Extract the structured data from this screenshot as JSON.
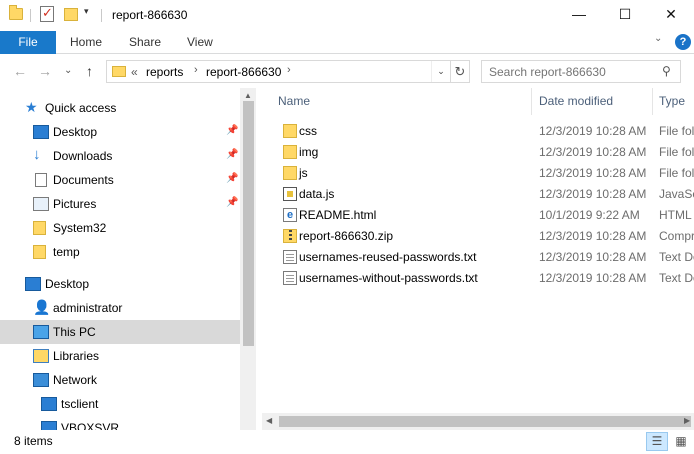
{
  "window": {
    "title": "report-866630",
    "minimize": "—",
    "maximize": "☐",
    "close": "✕"
  },
  "quick_toolbar": {
    "dropdown": "▾",
    "separator": "|"
  },
  "ribbon": {
    "tabs": [
      "File",
      "Home",
      "Share",
      "View"
    ],
    "expand": "⌄",
    "help": "?"
  },
  "navigation": {
    "back": "←",
    "forward": "→",
    "recent": "⌄",
    "up": "↑",
    "address": {
      "overflow": "«",
      "crumbs": [
        "reports",
        "report-866630"
      ],
      "chevron": "›",
      "dropdown": "⌄",
      "refresh": "↻"
    },
    "search": {
      "placeholder": "Search report-866630",
      "icon": "⚲"
    }
  },
  "sidebar": {
    "items": [
      {
        "label": "Quick access",
        "icon": "star-icon"
      },
      {
        "label": "Desktop",
        "icon": "desktop-icon",
        "pinned": true
      },
      {
        "label": "Downloads",
        "icon": "downloads-icon",
        "pinned": true
      },
      {
        "label": "Documents",
        "icon": "documents-icon",
        "pinned": true
      },
      {
        "label": "Pictures",
        "icon": "pictures-icon",
        "pinned": true
      },
      {
        "label": "System32",
        "icon": "folder-icon"
      },
      {
        "label": "temp",
        "icon": "folder-icon"
      },
      {
        "label": "Desktop",
        "icon": "desktop-icon"
      },
      {
        "label": "administrator",
        "icon": "user-icon"
      },
      {
        "label": "This PC",
        "icon": "computer-icon",
        "selected": true
      },
      {
        "label": "Libraries",
        "icon": "libraries-icon"
      },
      {
        "label": "Network",
        "icon": "network-icon"
      },
      {
        "label": "tsclient",
        "icon": "computer-icon"
      },
      {
        "label": "VBOXSVR",
        "icon": "computer-icon"
      }
    ],
    "pin_glyph": "📌"
  },
  "file_list": {
    "columns": {
      "name": "Name",
      "date": "Date modified",
      "type": "Type"
    },
    "sort_arrow": "^",
    "rows": [
      {
        "name": "css",
        "date": "12/3/2019 10:28 AM",
        "type": "File fol",
        "icon": "folder-icon"
      },
      {
        "name": "img",
        "date": "12/3/2019 10:28 AM",
        "type": "File fol",
        "icon": "folder-icon"
      },
      {
        "name": "js",
        "date": "12/3/2019 10:28 AM",
        "type": "File fol",
        "icon": "folder-icon"
      },
      {
        "name": "data.js",
        "date": "12/3/2019 10:28 AM",
        "type": "JavaSc",
        "icon": "js-file-icon"
      },
      {
        "name": "README.html",
        "date": "10/1/2019 9:22 AM",
        "type": "HTML",
        "icon": "html-file-icon"
      },
      {
        "name": "report-866630.zip",
        "date": "12/3/2019 10:28 AM",
        "type": "Compr",
        "icon": "zip-file-icon"
      },
      {
        "name": "usernames-reused-passwords.txt",
        "date": "12/3/2019 10:28 AM",
        "type": "Text Do",
        "icon": "text-file-icon"
      },
      {
        "name": "usernames-without-passwords.txt",
        "date": "12/3/2019 10:28 AM",
        "type": "Text Do",
        "icon": "text-file-icon"
      }
    ]
  },
  "status": {
    "count": "8 items"
  },
  "colors": {
    "accent": "#1979ca",
    "selected_row": "#d9d9d9",
    "header_text": "#4c607a",
    "folder": "#ffd866"
  }
}
